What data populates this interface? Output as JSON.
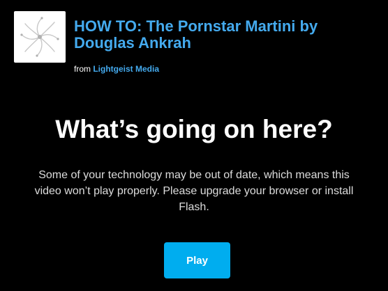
{
  "header": {
    "logo_icon": "starburst-logo-icon",
    "title": "HOW TO: The Pornstar Martini by Douglas Ankrah",
    "byline_prefix": "from",
    "publisher": "Lightgeist Media"
  },
  "notice": {
    "heading": "What’s going on here?",
    "message": "Some of your technology may be out of date, which means this video won’t play properly. Please upgrade your browser or install Flash.",
    "play_label": "Play"
  },
  "colors": {
    "background": "#000000",
    "link": "#44aaee",
    "button": "#00adef",
    "text": "#ffffff"
  }
}
